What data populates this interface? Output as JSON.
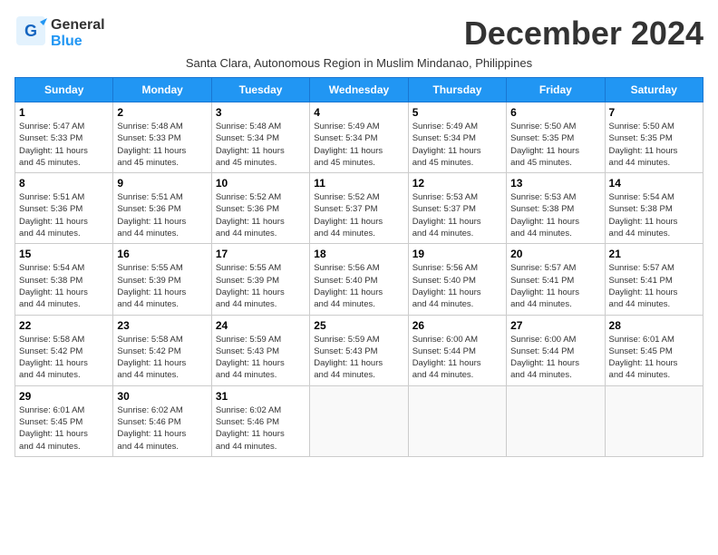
{
  "header": {
    "logo_line1": "General",
    "logo_line2": "Blue",
    "month_title": "December 2024",
    "subtitle": "Santa Clara, Autonomous Region in Muslim Mindanao, Philippines"
  },
  "days_of_week": [
    "Sunday",
    "Monday",
    "Tuesday",
    "Wednesday",
    "Thursday",
    "Friday",
    "Saturday"
  ],
  "weeks": [
    [
      {
        "day": "1",
        "info": "Sunrise: 5:47 AM\nSunset: 5:33 PM\nDaylight: 11 hours\nand 45 minutes."
      },
      {
        "day": "2",
        "info": "Sunrise: 5:48 AM\nSunset: 5:33 PM\nDaylight: 11 hours\nand 45 minutes."
      },
      {
        "day": "3",
        "info": "Sunrise: 5:48 AM\nSunset: 5:34 PM\nDaylight: 11 hours\nand 45 minutes."
      },
      {
        "day": "4",
        "info": "Sunrise: 5:49 AM\nSunset: 5:34 PM\nDaylight: 11 hours\nand 45 minutes."
      },
      {
        "day": "5",
        "info": "Sunrise: 5:49 AM\nSunset: 5:34 PM\nDaylight: 11 hours\nand 45 minutes."
      },
      {
        "day": "6",
        "info": "Sunrise: 5:50 AM\nSunset: 5:35 PM\nDaylight: 11 hours\nand 45 minutes."
      },
      {
        "day": "7",
        "info": "Sunrise: 5:50 AM\nSunset: 5:35 PM\nDaylight: 11 hours\nand 44 minutes."
      }
    ],
    [
      {
        "day": "8",
        "info": "Sunrise: 5:51 AM\nSunset: 5:36 PM\nDaylight: 11 hours\nand 44 minutes."
      },
      {
        "day": "9",
        "info": "Sunrise: 5:51 AM\nSunset: 5:36 PM\nDaylight: 11 hours\nand 44 minutes."
      },
      {
        "day": "10",
        "info": "Sunrise: 5:52 AM\nSunset: 5:36 PM\nDaylight: 11 hours\nand 44 minutes."
      },
      {
        "day": "11",
        "info": "Sunrise: 5:52 AM\nSunset: 5:37 PM\nDaylight: 11 hours\nand 44 minutes."
      },
      {
        "day": "12",
        "info": "Sunrise: 5:53 AM\nSunset: 5:37 PM\nDaylight: 11 hours\nand 44 minutes."
      },
      {
        "day": "13",
        "info": "Sunrise: 5:53 AM\nSunset: 5:38 PM\nDaylight: 11 hours\nand 44 minutes."
      },
      {
        "day": "14",
        "info": "Sunrise: 5:54 AM\nSunset: 5:38 PM\nDaylight: 11 hours\nand 44 minutes."
      }
    ],
    [
      {
        "day": "15",
        "info": "Sunrise: 5:54 AM\nSunset: 5:38 PM\nDaylight: 11 hours\nand 44 minutes."
      },
      {
        "day": "16",
        "info": "Sunrise: 5:55 AM\nSunset: 5:39 PM\nDaylight: 11 hours\nand 44 minutes."
      },
      {
        "day": "17",
        "info": "Sunrise: 5:55 AM\nSunset: 5:39 PM\nDaylight: 11 hours\nand 44 minutes."
      },
      {
        "day": "18",
        "info": "Sunrise: 5:56 AM\nSunset: 5:40 PM\nDaylight: 11 hours\nand 44 minutes."
      },
      {
        "day": "19",
        "info": "Sunrise: 5:56 AM\nSunset: 5:40 PM\nDaylight: 11 hours\nand 44 minutes."
      },
      {
        "day": "20",
        "info": "Sunrise: 5:57 AM\nSunset: 5:41 PM\nDaylight: 11 hours\nand 44 minutes."
      },
      {
        "day": "21",
        "info": "Sunrise: 5:57 AM\nSunset: 5:41 PM\nDaylight: 11 hours\nand 44 minutes."
      }
    ],
    [
      {
        "day": "22",
        "info": "Sunrise: 5:58 AM\nSunset: 5:42 PM\nDaylight: 11 hours\nand 44 minutes."
      },
      {
        "day": "23",
        "info": "Sunrise: 5:58 AM\nSunset: 5:42 PM\nDaylight: 11 hours\nand 44 minutes."
      },
      {
        "day": "24",
        "info": "Sunrise: 5:59 AM\nSunset: 5:43 PM\nDaylight: 11 hours\nand 44 minutes."
      },
      {
        "day": "25",
        "info": "Sunrise: 5:59 AM\nSunset: 5:43 PM\nDaylight: 11 hours\nand 44 minutes."
      },
      {
        "day": "26",
        "info": "Sunrise: 6:00 AM\nSunset: 5:44 PM\nDaylight: 11 hours\nand 44 minutes."
      },
      {
        "day": "27",
        "info": "Sunrise: 6:00 AM\nSunset: 5:44 PM\nDaylight: 11 hours\nand 44 minutes."
      },
      {
        "day": "28",
        "info": "Sunrise: 6:01 AM\nSunset: 5:45 PM\nDaylight: 11 hours\nand 44 minutes."
      }
    ],
    [
      {
        "day": "29",
        "info": "Sunrise: 6:01 AM\nSunset: 5:45 PM\nDaylight: 11 hours\nand 44 minutes."
      },
      {
        "day": "30",
        "info": "Sunrise: 6:02 AM\nSunset: 5:46 PM\nDaylight: 11 hours\nand 44 minutes."
      },
      {
        "day": "31",
        "info": "Sunrise: 6:02 AM\nSunset: 5:46 PM\nDaylight: 11 hours\nand 44 minutes."
      },
      {
        "day": "",
        "info": ""
      },
      {
        "day": "",
        "info": ""
      },
      {
        "day": "",
        "info": ""
      },
      {
        "day": "",
        "info": ""
      }
    ]
  ]
}
